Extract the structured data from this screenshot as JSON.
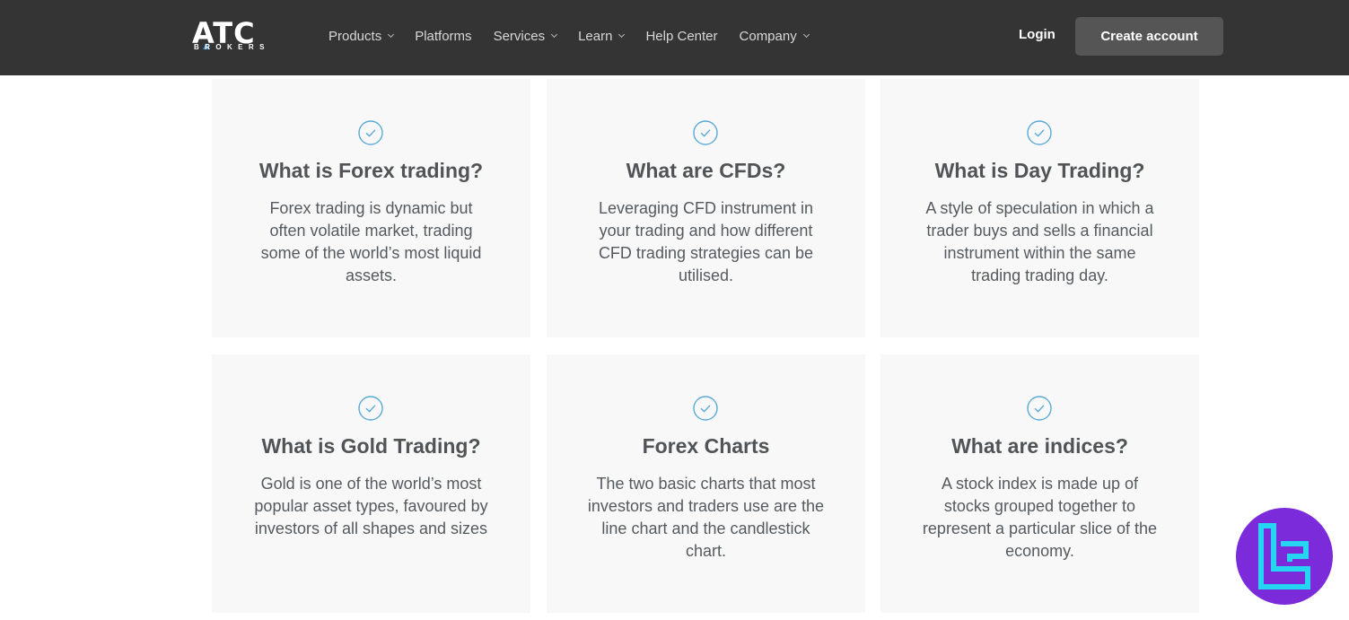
{
  "header": {
    "logo_word": "ATC",
    "logo_sub": "BROKERS",
    "nav": [
      {
        "label": "Products",
        "dropdown": true
      },
      {
        "label": "Platforms",
        "dropdown": false
      },
      {
        "label": "Services",
        "dropdown": true
      },
      {
        "label": "Learn",
        "dropdown": true
      },
      {
        "label": "Help Center",
        "dropdown": false
      },
      {
        "label": "Company",
        "dropdown": true
      }
    ],
    "login_label": "Login",
    "create_account_label": "Create account"
  },
  "cards": [
    {
      "title": "What is Forex trading?",
      "text": "Forex trading is dynamic but often volatile market, trading some of the world’s most liquid assets."
    },
    {
      "title": "What are CFDs?",
      "text": "Leveraging CFD instrument in your trading and how different CFD trading strategies can be utilised."
    },
    {
      "title": "What is Day Trading?",
      "text": "A style of speculation in which a trader buys and sells a financial instrument within the same trading trading day."
    },
    {
      "title": "What is Gold Trading?",
      "text": "Gold is one of the world’s most popular asset types, favoured by investors of all shapes and sizes"
    },
    {
      "title": "Forex Charts",
      "text": "The two basic charts that most investors and traders use are the line chart and the candlestick chart."
    },
    {
      "title": "What are indices?",
      "text": "A stock index is made up of stocks grouped together to represent a particular slice of the economy."
    }
  ],
  "colors": {
    "header_bg": "#343434",
    "card_bg": "#f8f8f8",
    "check_accent": "#5aa9d6",
    "badge_bg": "#7b2bd9",
    "badge_icon": "#24d6f2"
  }
}
